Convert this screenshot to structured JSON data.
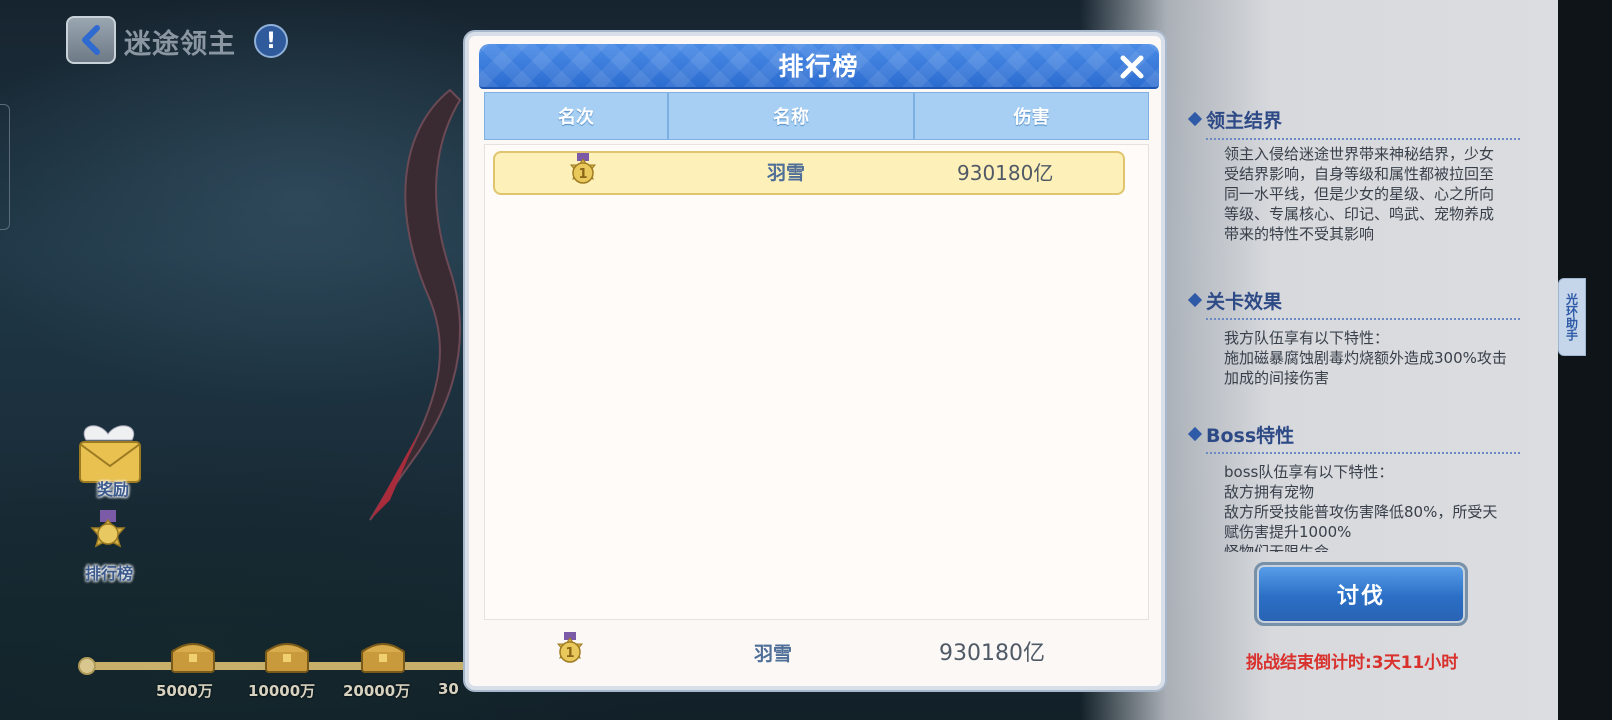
{
  "header": {
    "title": "迷途领主"
  },
  "side_buttons": {
    "reward_label": "奖励",
    "ranking_label": "排行榜"
  },
  "milestones": [
    "5000万",
    "10000万",
    "20000万",
    "30"
  ],
  "dialog": {
    "title": "排行榜",
    "columns": [
      "名次",
      "名称",
      "伤害"
    ],
    "rows": [
      {
        "rank": 1,
        "name": "羽雪",
        "damage": "930180亿"
      }
    ],
    "my_rank": {
      "rank": 1,
      "name": "羽雪",
      "damage": "930180亿"
    }
  },
  "info_panel": {
    "sections": [
      {
        "title": "领主结界",
        "body": "领主入侵给迷途世界带来神秘结界，少女受结界影响，自身等级和属性都被拉回至同一水平线，但是少女的星级、心之所向等级、专属核心、印记、鸣武、宠物养成带来的特性不受其影响"
      },
      {
        "title": "关卡效果",
        "body": "我方队伍享有以下特性：\n施加磁暴腐蚀剧毒灼烧额外造成300%攻击加成的间接伤害"
      },
      {
        "title": "Boss特性",
        "body": "boss队伍享有以下特性：\n敌方拥有宠物\n敌方所受技能普攻伤害降低80%，所受天赋伤害提升1000%\n怪物们无限生命"
      }
    ],
    "fight_label": "讨伐",
    "countdown": "挑战结束倒计时:3天11小时"
  },
  "helper_tab": {
    "label": "光环助手"
  },
  "colors": {
    "accent_blue": "#2b6cd0",
    "header_blue": "#a6cff3",
    "gold_row": "#fdf0b8",
    "countdown_red": "#d9312d"
  }
}
